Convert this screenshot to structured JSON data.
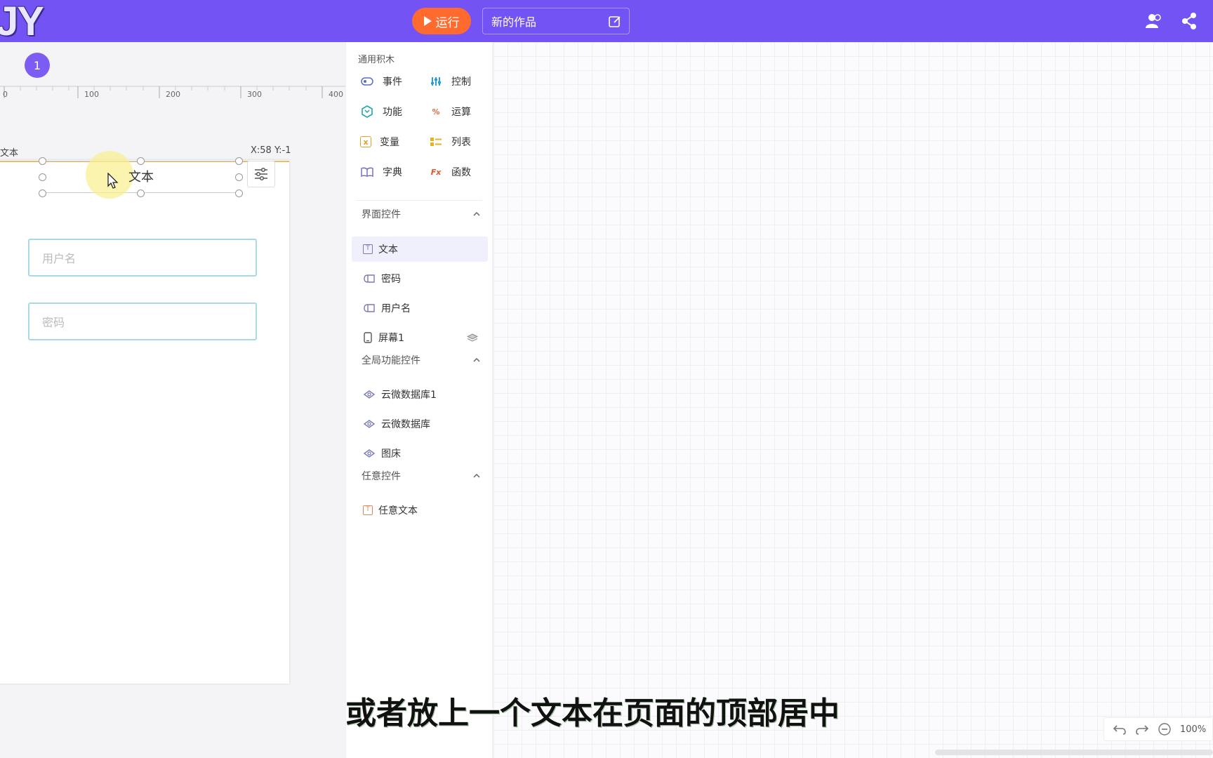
{
  "topbar": {
    "logo_text": "JY",
    "run_label": "运行",
    "project_name": "新的作品",
    "colors": {
      "bar": "#7453f4",
      "run": "#ff6a2f"
    }
  },
  "canvas": {
    "screen_tab_number": "1",
    "ruler_labels": [
      "0",
      "100",
      "200",
      "300",
      "400"
    ],
    "selected_label": "文本",
    "coord_readout": "X:58 Y:-1",
    "text_widget": "文本",
    "username_placeholder": "用户名",
    "password_placeholder": "密码"
  },
  "palette": {
    "general_title": "通用积木",
    "blocks": [
      {
        "label": "事件",
        "icon": "toggle-icon"
      },
      {
        "label": "控制",
        "icon": "sliders-icon"
      },
      {
        "label": "功能",
        "icon": "hexagon-icon"
      },
      {
        "label": "运算",
        "icon": "percent-icon"
      },
      {
        "label": "变量",
        "icon": "variable-icon"
      },
      {
        "label": "列表",
        "icon": "list-icon"
      },
      {
        "label": "字典",
        "icon": "book-icon"
      },
      {
        "label": "函数",
        "icon": "fx-icon"
      }
    ],
    "ui_section": "界面控件",
    "ui_items": [
      "文本",
      "密码",
      "用户名",
      "屏幕1"
    ],
    "global_section": "全局功能控件",
    "global_items": [
      "云微数据库1",
      "云微数据库",
      "图床"
    ],
    "any_section": "任意控件",
    "any_items": [
      "任意文本"
    ]
  },
  "workspace": {
    "subtitle": "或者放上一个文本在页面的顶部居中",
    "zoom": "100%"
  }
}
